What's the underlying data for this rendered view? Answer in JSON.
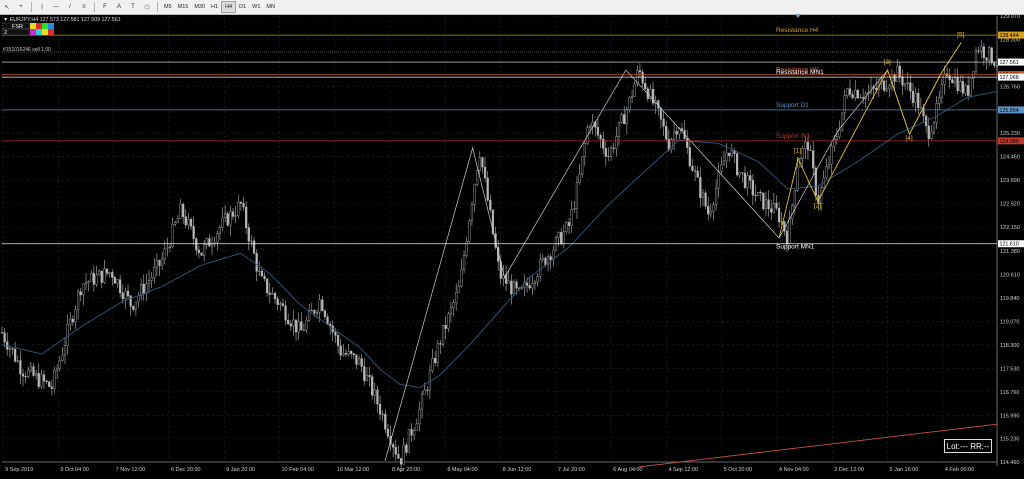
{
  "toolbar": {
    "tools": [
      {
        "name": "cursor-icon",
        "glyph": "↖"
      },
      {
        "name": "crosshair-icon",
        "glyph": "+"
      },
      {
        "name": "vertical-line-icon",
        "glyph": "|"
      },
      {
        "name": "horizontal-line-icon",
        "glyph": "—"
      },
      {
        "name": "trendline-icon",
        "glyph": "/"
      },
      {
        "name": "channel-icon",
        "glyph": "≡"
      },
      {
        "name": "fibonacci-icon",
        "glyph": "F"
      },
      {
        "name": "text-icon",
        "glyph": "A"
      },
      {
        "name": "label-icon",
        "glyph": "T"
      },
      {
        "name": "shapes-icon",
        "glyph": "⬠"
      }
    ],
    "timeframes": [
      "M5",
      "M15",
      "M30",
      "H1",
      "H4",
      "D1",
      "W1",
      "MN"
    ],
    "active_timeframe": "H4"
  },
  "info": {
    "symbol_line": "▼ EURJPY,H4  127.573 127.581 127.509 127.561",
    "indicator_name": "FSR",
    "indicator_row": "2",
    "order_line": "#151016246 sell 1.00"
  },
  "colors": {
    "background": "#000000",
    "grid": "#2a2a2a",
    "candle": "#b8b8b8",
    "ma": "#2e5a86",
    "resistance_h4": "#d6a21e",
    "resistance_w1": "#d05a2a",
    "resistance_mn1": "#ffffff",
    "support_d1": "#5b93c7",
    "support_w1": "#c0392b",
    "support_mn1": "#ffffff",
    "wave": "#e6c229",
    "zigzag": "#cfcfcf",
    "trend": "#c9583a"
  },
  "chart_data": {
    "type": "candlestick",
    "symbol": "EURJPY",
    "timeframe": "H4",
    "ylim": [
      114.46,
      129.07
    ],
    "y_ticks": [
      129.07,
      128.3,
      127.561,
      127.068,
      126.76,
      125.99,
      125.23,
      124.46,
      123.69,
      122.92,
      122.15,
      121.61,
      121.38,
      120.61,
      119.84,
      119.07,
      118.3,
      117.53,
      116.76,
      115.99,
      115.23,
      114.46
    ],
    "x_ticks": [
      "9 Sep 2019",
      "9 Oct 04:00",
      "7 Nov 12:00",
      "6 Dec 20:00",
      "9 Jan 20:00",
      "10 Feb 04:00",
      "10 Mar 12:00",
      "8 Apr 20:00",
      "8 May 04:00",
      "8 Jun 12:00",
      "7 Jul 20:00",
      "6 Aug 04:00",
      "4 Sep 12:00",
      "5 Oct 20:00",
      "4 Nov 04:00",
      "3 Dec 12:00",
      "5 Jan 16:00",
      "4 Feb 00:00"
    ],
    "price_path": [
      [
        0,
        118.7
      ],
      [
        0.02,
        117.5
      ],
      [
        0.05,
        116.9
      ],
      [
        0.08,
        120.3
      ],
      [
        0.11,
        120.7
      ],
      [
        0.13,
        119.6
      ],
      [
        0.16,
        121.0
      ],
      [
        0.18,
        122.7
      ],
      [
        0.2,
        121.3
      ],
      [
        0.22,
        122.2
      ],
      [
        0.24,
        122.9
      ],
      [
        0.26,
        120.4
      ],
      [
        0.28,
        119.6
      ],
      [
        0.3,
        118.7
      ],
      [
        0.32,
        119.8
      ],
      [
        0.34,
        118.1
      ],
      [
        0.36,
        117.7
      ],
      [
        0.38,
        116.2
      ],
      [
        0.4,
        114.5
      ],
      [
        0.42,
        116.2
      ],
      [
        0.44,
        118.4
      ],
      [
        0.46,
        120.2
      ],
      [
        0.47,
        122.6
      ],
      [
        0.48,
        124.7
      ],
      [
        0.5,
        120.6
      ],
      [
        0.52,
        119.9
      ],
      [
        0.55,
        121.3
      ],
      [
        0.57,
        122.2
      ],
      [
        0.58,
        123.7
      ],
      [
        0.59,
        125.7
      ],
      [
        0.61,
        124.5
      ],
      [
        0.63,
        126.2
      ],
      [
        0.64,
        127.3
      ],
      [
        0.66,
        125.8
      ],
      [
        0.67,
        124.9
      ],
      [
        0.68,
        125.6
      ],
      [
        0.7,
        123.5
      ],
      [
        0.71,
        122.6
      ],
      [
        0.73,
        124.8
      ],
      [
        0.74,
        124.0
      ],
      [
        0.76,
        123.1
      ],
      [
        0.78,
        122.6
      ],
      [
        0.79,
        121.8
      ],
      [
        0.8,
        124.4
      ],
      [
        0.81,
        124.9
      ],
      [
        0.82,
        123.0
      ],
      [
        0.84,
        125.3
      ],
      [
        0.85,
        126.7
      ],
      [
        0.87,
        126.5
      ],
      [
        0.88,
        126.7
      ],
      [
        0.9,
        127.2
      ],
      [
        0.92,
        126.3
      ],
      [
        0.93,
        125.2
      ],
      [
        0.94,
        126.0
      ],
      [
        0.95,
        127.3
      ],
      [
        0.97,
        126.5
      ],
      [
        0.98,
        128.1
      ],
      [
        1,
        127.56
      ]
    ],
    "ma_path": [
      [
        0,
        118.3
      ],
      [
        0.04,
        118.0
      ],
      [
        0.08,
        118.9
      ],
      [
        0.12,
        119.7
      ],
      [
        0.16,
        120.2
      ],
      [
        0.2,
        120.9
      ],
      [
        0.24,
        121.3
      ],
      [
        0.27,
        120.6
      ],
      [
        0.3,
        119.6
      ],
      [
        0.33,
        118.9
      ],
      [
        0.36,
        118.2
      ],
      [
        0.38,
        117.5
      ],
      [
        0.4,
        117.0
      ],
      [
        0.42,
        116.9
      ],
      [
        0.44,
        117.3
      ],
      [
        0.47,
        118.3
      ],
      [
        0.5,
        119.4
      ],
      [
        0.53,
        120.5
      ],
      [
        0.57,
        121.5
      ],
      [
        0.61,
        122.9
      ],
      [
        0.65,
        124.1
      ],
      [
        0.68,
        125.0
      ],
      [
        0.72,
        124.9
      ],
      [
        0.76,
        124.3
      ],
      [
        0.79,
        123.4
      ],
      [
        0.82,
        123.5
      ],
      [
        0.86,
        124.3
      ],
      [
        0.9,
        125.2
      ],
      [
        0.94,
        125.8
      ],
      [
        0.97,
        126.4
      ],
      [
        1,
        126.6
      ]
    ],
    "zigzag": [
      [
        0.385,
        114.5
      ],
      [
        0.473,
        124.75
      ],
      [
        0.505,
        120.5
      ],
      [
        0.627,
        127.3
      ],
      [
        0.781,
        121.8
      ],
      [
        0.84,
        125.3
      ],
      [
        0.89,
        127.3
      ],
      [
        0.912,
        125.2
      ],
      [
        0.944,
        127.2
      ],
      [
        0.964,
        128.2
      ]
    ],
    "wave_path": [
      [
        0.781,
        121.8
      ],
      [
        0.8,
        124.4
      ],
      [
        0.82,
        123.0
      ],
      [
        0.89,
        127.3
      ],
      [
        0.912,
        125.2
      ],
      [
        0.944,
        127.2
      ],
      [
        0.964,
        128.2
      ]
    ],
    "wave_labels": [
      {
        "text": "[1]",
        "x": 0.8,
        "y": 124.6
      },
      {
        "text": "[2]",
        "x": 0.82,
        "y": 122.8
      },
      {
        "text": "[3]",
        "x": 0.89,
        "y": 127.5
      },
      {
        "text": "[4]",
        "x": 0.912,
        "y": 125.0
      },
      {
        "text": "[5]",
        "x": 0.964,
        "y": 128.4
      }
    ],
    "levels": [
      {
        "name": "Resistance H4",
        "price": 128.444,
        "label": "128.444",
        "color_key": "resistance_h4",
        "text": "Resistance H4"
      },
      {
        "name": "Ask",
        "price": 127.561,
        "label": "127.561",
        "color_key": "resistance_mn1",
        "text": ""
      },
      {
        "name": "Resistance W1",
        "price": 127.15,
        "label": "127.150",
        "color_key": "resistance_w1",
        "text": "Resistance W1"
      },
      {
        "name": "Resistance MN1",
        "price": 127.068,
        "label": "127.068",
        "color_key": "resistance_mn1",
        "text": "Resistance MN1"
      },
      {
        "name": "Support D1",
        "price": 125.994,
        "label": "125.994",
        "color_key": "support_d1",
        "text": "Support D1"
      },
      {
        "name": "Support W1",
        "price": 124.98,
        "label": "124.980",
        "color_key": "support_w1",
        "text": "Support W1"
      },
      {
        "name": "Support MN1",
        "price": 121.61,
        "label": "121.610",
        "color_key": "support_mn1",
        "text": "Support MN1"
      }
    ],
    "trendline": [
      [
        0.64,
        114.3
      ],
      [
        1,
        115.7
      ]
    ]
  },
  "lot_box": {
    "label": "Lot:--- RR:--"
  }
}
